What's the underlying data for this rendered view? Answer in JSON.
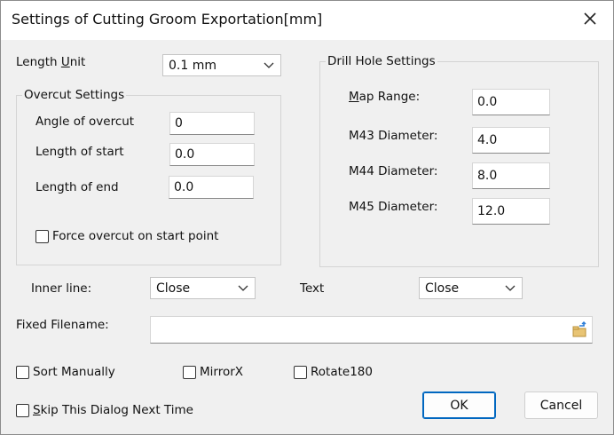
{
  "window": {
    "title": "Settings of Cutting Groom Exportation[mm]"
  },
  "length_unit": {
    "label_pre": "Length ",
    "label_u": "U",
    "label_post": "nit",
    "value": "0.1 mm"
  },
  "overcut": {
    "group_title": "Overcut Settings",
    "angle_label": "Angle of overcut",
    "angle_value": "0",
    "start_label": "Length of start",
    "start_value": "0.0",
    "end_label": "Length of end",
    "end_value": "0.0",
    "force_label": "Force overcut on start point"
  },
  "drill": {
    "group_title": "Drill Hole Settings",
    "map_range_u": "M",
    "map_range_rest": "ap Range:",
    "map_range_value": "0.0",
    "m43_label": "M43 Diameter:",
    "m43_value": "4.0",
    "m44_label": "M44 Diameter:",
    "m44_value": "8.0",
    "m45_label": "M45 Diameter:",
    "m45_value": "12.0"
  },
  "inner_line": {
    "label": "Inner line:",
    "value": "Close"
  },
  "text_opt": {
    "label": "Text",
    "value": "Close"
  },
  "fixed_filename": {
    "label": "Fixed Filename:",
    "value": ""
  },
  "options": {
    "sort_manually": "Sort Manually",
    "mirrorx": "MirrorX",
    "rotate180": "Rotate180",
    "skip_u": "S",
    "skip_rest": "kip This Dialog Next Time"
  },
  "buttons": {
    "ok": "OK",
    "cancel": "Cancel"
  }
}
